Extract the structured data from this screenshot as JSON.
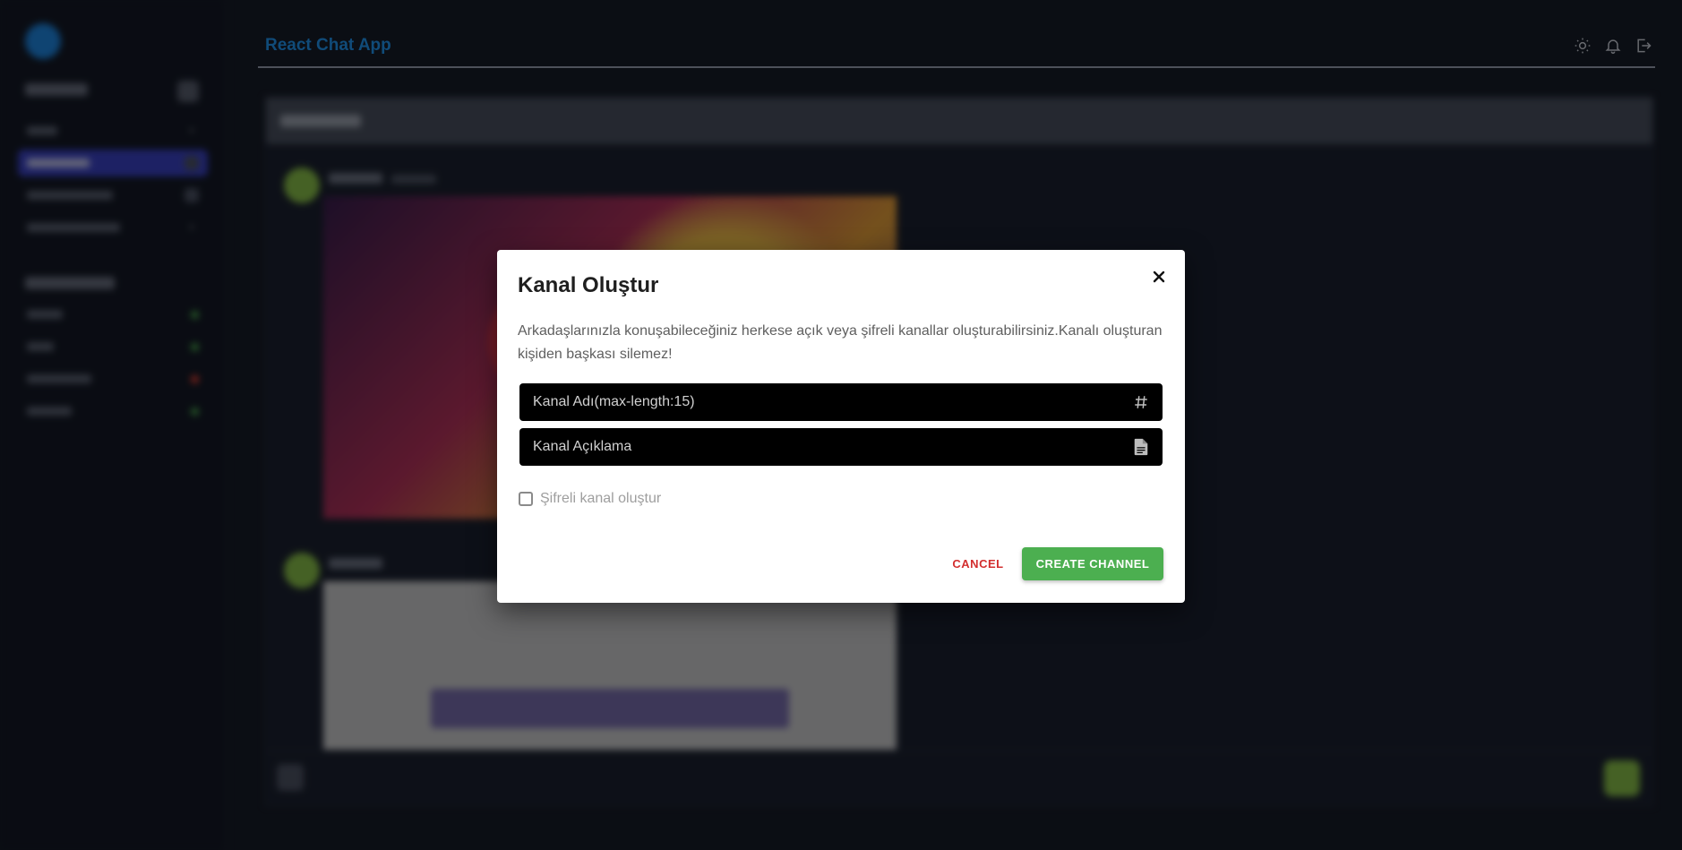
{
  "app": {
    "title": "React Chat App",
    "icons": [
      "sun-icon",
      "bell-icon",
      "logout-icon"
    ]
  },
  "dialog": {
    "title": "Kanal Oluştur",
    "description": "Arkadaşlarınızla konuşabileceğiniz herkese açık veya şifreli kanallar oluşturabilirsiniz.Kanalı oluşturan kişiden başkası silemez!",
    "channel_name_placeholder": "Kanal Adı(max-length:15)",
    "channel_name_icon": "hashtag-icon",
    "channel_description_placeholder": "Kanal Açıklama",
    "channel_description_icon": "document-icon",
    "encrypted_checkbox_label": "Şifreli kanal oluştur",
    "encrypted_checked": false,
    "cancel_label": "CANCEL",
    "create_label": "CREATE CHANNEL",
    "colors": {
      "create": "#4caf50",
      "cancel": "#d32f2f",
      "field_bg": "#000000"
    }
  }
}
